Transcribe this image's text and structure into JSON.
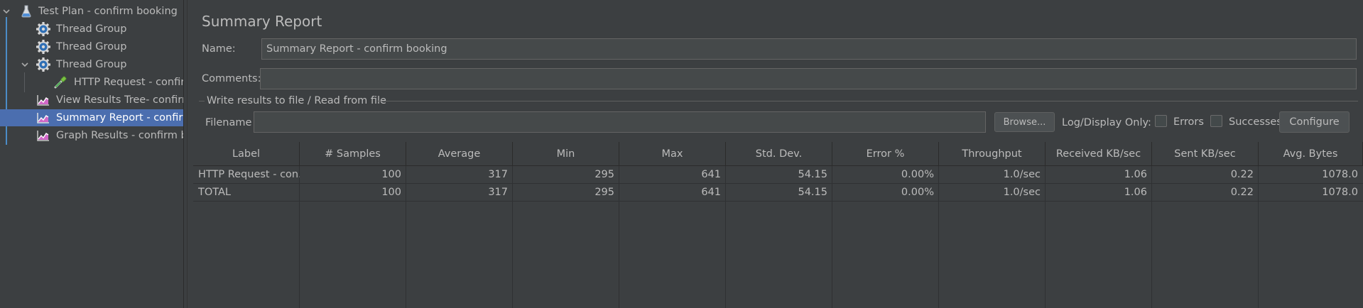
{
  "tree": {
    "items": [
      {
        "label": "Test Plan - confirm booking",
        "icon": "flask-icon"
      },
      {
        "label": "Thread Group",
        "icon": "gear-icon"
      },
      {
        "label": "Thread Group",
        "icon": "gear-icon"
      },
      {
        "label": "Thread Group",
        "icon": "gear-icon"
      },
      {
        "label": "HTTP Request - confirm",
        "icon": "pipette-icon"
      },
      {
        "label": "View Results Tree- confirm",
        "icon": "chart-icon"
      },
      {
        "label": "Summary Report - confirm",
        "icon": "chart-icon"
      },
      {
        "label": "Graph Results - confirm boo",
        "icon": "chart-icon"
      }
    ],
    "selected_index": 6
  },
  "panel": {
    "title": "Summary Report",
    "name_label": "Name:",
    "name_value": "Summary Report - confirm booking",
    "comments_label": "Comments:",
    "comments_value": "",
    "file_group_label": "Write results to file / Read from file",
    "filename_label": "Filename",
    "filename_value": "",
    "browse_label": "Browse...",
    "log_display_label": "Log/Display Only:",
    "errors_label": "Errors",
    "successes_label": "Successes",
    "configure_label": "Configure"
  },
  "table": {
    "columns": [
      "Label",
      "# Samples",
      "Average",
      "Min",
      "Max",
      "Std. Dev.",
      "Error %",
      "Throughput",
      "Received KB/sec",
      "Sent KB/sec",
      "Avg. Bytes"
    ],
    "rows": [
      [
        "HTTP Request - con...",
        "100",
        "317",
        "295",
        "641",
        "54.15",
        "0.00%",
        "1.0/sec",
        "1.06",
        "0.22",
        "1078.0"
      ],
      [
        "TOTAL",
        "100",
        "317",
        "295",
        "641",
        "54.15",
        "0.00%",
        "1.0/sec",
        "1.06",
        "0.22",
        "1078.0"
      ]
    ]
  },
  "colors": {
    "background": "#3c3f41",
    "selection": "#4b6eaf",
    "text": "#bbbbbb",
    "tree_line": "#4b8cc7"
  }
}
